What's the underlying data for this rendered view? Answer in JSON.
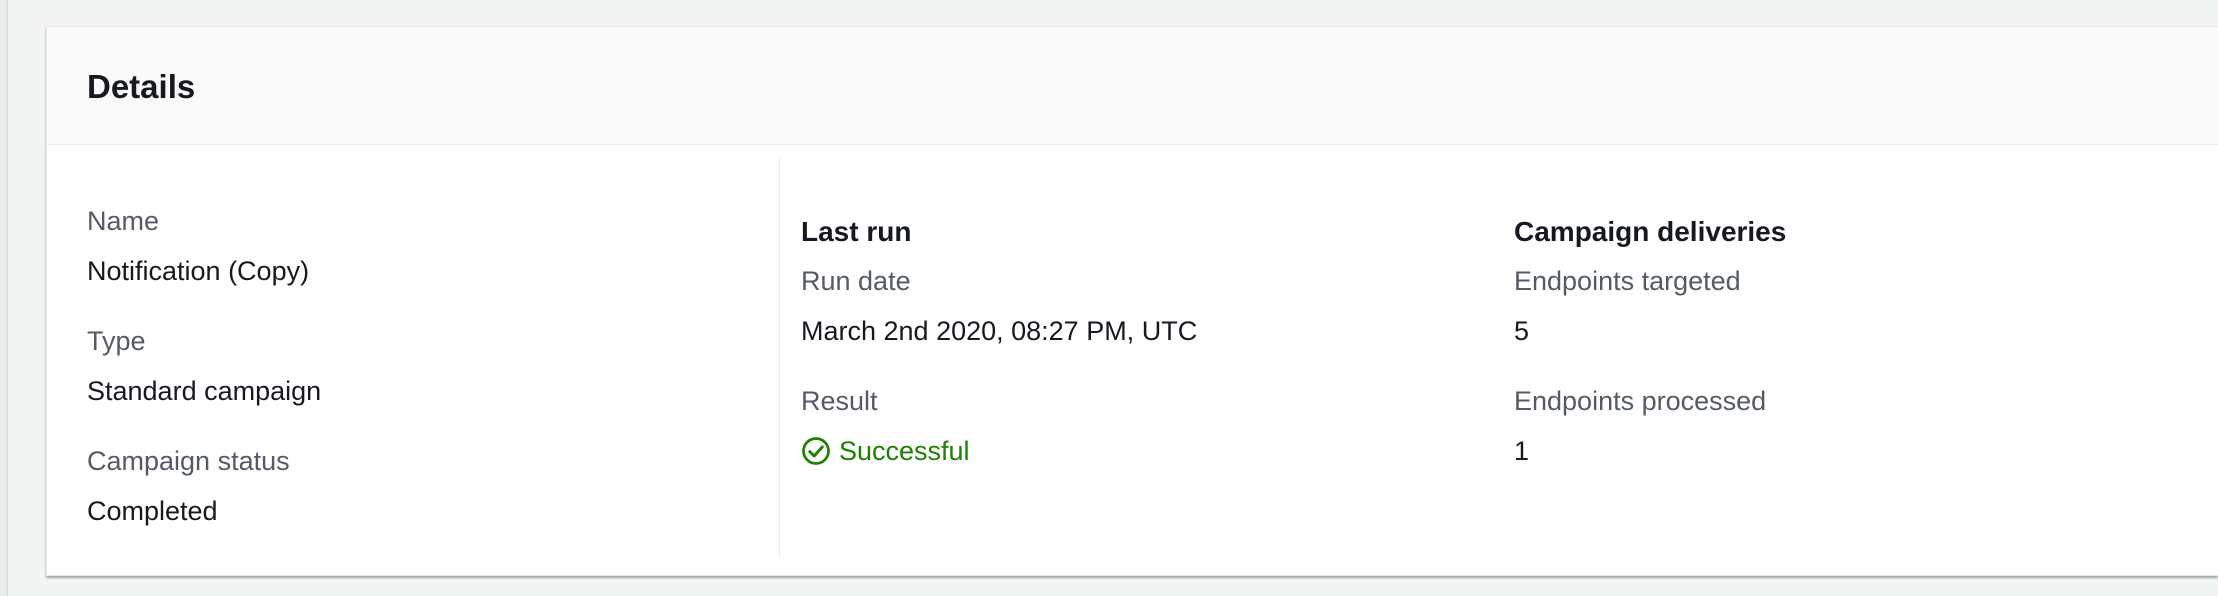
{
  "details": {
    "title": "Details",
    "general": {
      "name_label": "Name",
      "name_value": "Notification (Copy)",
      "type_label": "Type",
      "type_value": "Standard campaign",
      "status_label": "Campaign status",
      "status_value": "Completed"
    },
    "last_run": {
      "heading": "Last run",
      "run_date_label": "Run date",
      "run_date_value": "March 2nd 2020, 08:27 PM, UTC",
      "result_label": "Result",
      "result_value": "Successful",
      "result_icon": "check-circle-icon",
      "result_color": "#1d8102"
    },
    "deliveries": {
      "heading": "Campaign deliveries",
      "targeted_label": "Endpoints targeted",
      "targeted_value": "5",
      "processed_label": "Endpoints processed",
      "processed_value": "1"
    }
  }
}
